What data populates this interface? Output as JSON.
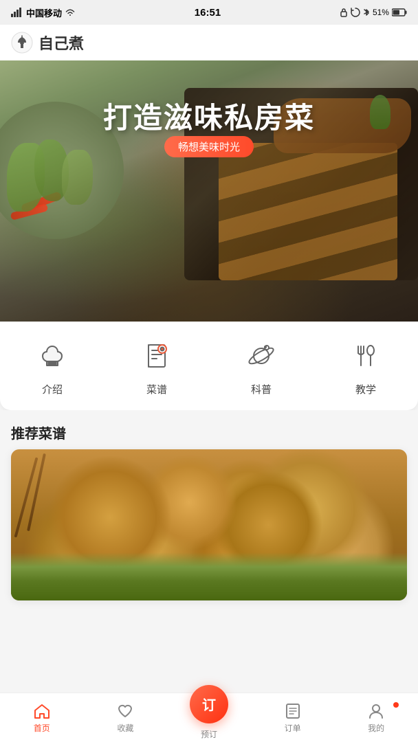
{
  "statusBar": {
    "carrier": "中国移动",
    "signal": "📶",
    "wifi": "WiFi",
    "time": "16:51",
    "battery": "51%"
  },
  "header": {
    "logoAlt": "chef-hat",
    "title": "自己煮"
  },
  "hero": {
    "mainTitle": "打造滋味私房菜",
    "subtitle": "畅想美味时光"
  },
  "categories": [
    {
      "id": "intro",
      "iconName": "chef-hat-icon",
      "label": "介绍"
    },
    {
      "id": "recipes",
      "iconName": "recipe-book-icon",
      "label": "菜谱"
    },
    {
      "id": "knowledge",
      "iconName": "planet-icon",
      "label": "科普"
    },
    {
      "id": "tutorial",
      "iconName": "fork-spoon-icon",
      "label": "教学"
    }
  ],
  "recommendSection": {
    "title": "推荐菜谱"
  },
  "bottomNav": [
    {
      "id": "home",
      "label": "首页",
      "icon": "home-icon",
      "active": true
    },
    {
      "id": "favorites",
      "label": "收藏",
      "icon": "heart-icon",
      "active": false
    },
    {
      "id": "order",
      "label": "预订",
      "icon": "order-center-icon",
      "active": false,
      "center": true,
      "text": "订"
    },
    {
      "id": "orders",
      "label": "订单",
      "icon": "list-icon",
      "active": false
    },
    {
      "id": "profile",
      "label": "我的",
      "icon": "user-icon",
      "active": false
    }
  ]
}
